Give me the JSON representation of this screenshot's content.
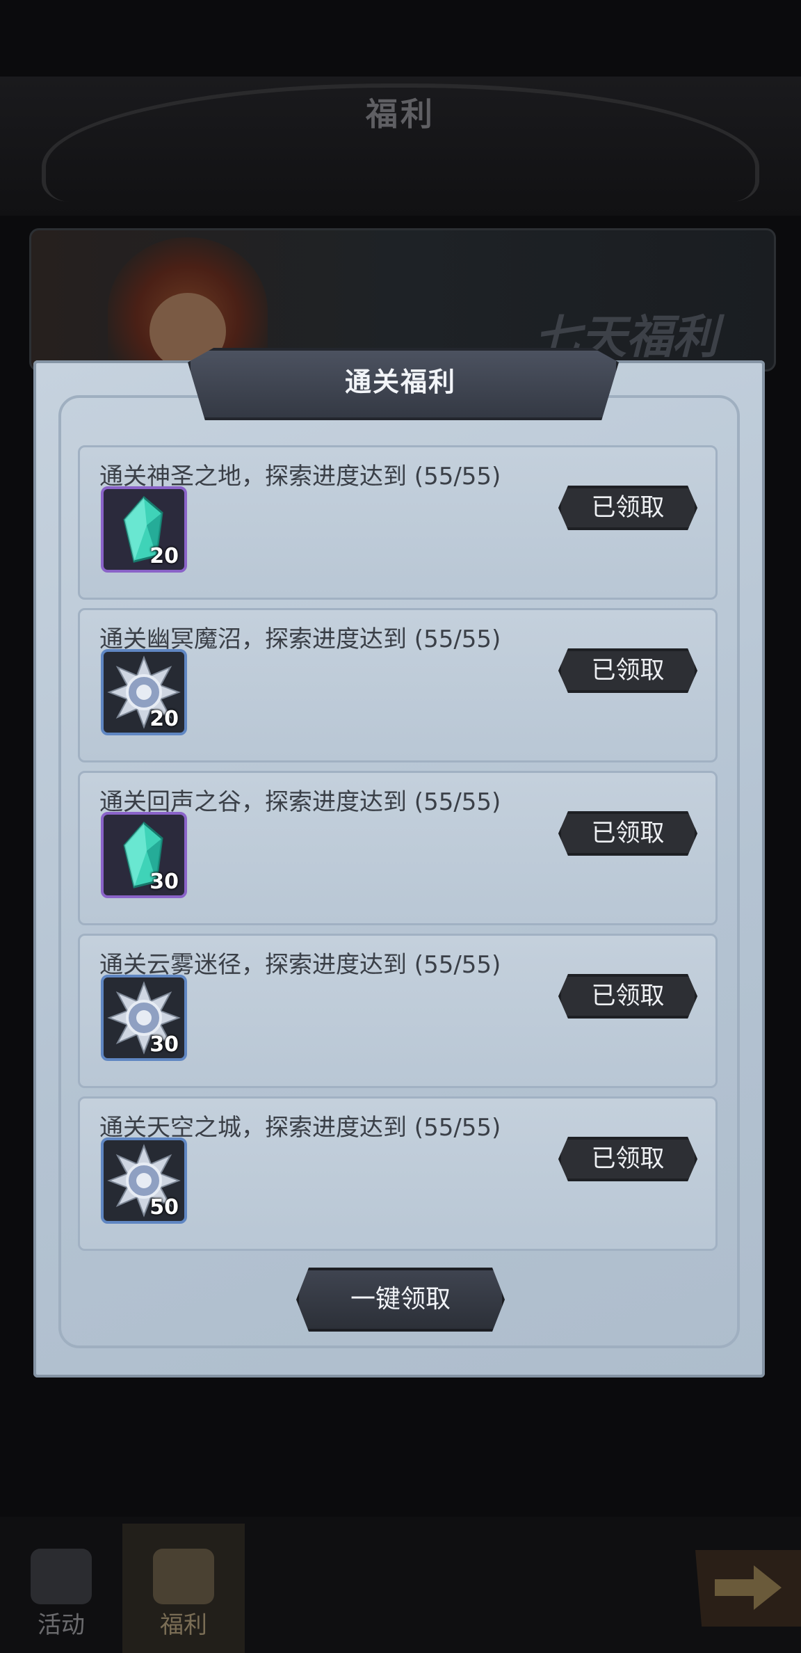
{
  "header": {
    "title": "福利"
  },
  "banner": {
    "title": "七天福利"
  },
  "panel": {
    "title": "通关福利"
  },
  "rows": [
    {
      "text": "通关神圣之地，探索进度达到 (55/55)",
      "item_icon": "crystal-icon",
      "item_frame": "purple",
      "count": "20",
      "button": "已领取"
    },
    {
      "text": "通关幽冥魔沼，探索进度达到 (55/55)",
      "item_icon": "silver-medal-icon",
      "item_frame": "blue",
      "count": "20",
      "button": "已领取"
    },
    {
      "text": "通关回声之谷，探索进度达到 (55/55)",
      "item_icon": "crystal-icon",
      "item_frame": "purple",
      "count": "30",
      "button": "已领取"
    },
    {
      "text": "通关云雾迷径，探索进度达到 (55/55)",
      "item_icon": "silver-medal-icon",
      "item_frame": "blue",
      "count": "30",
      "button": "已领取"
    },
    {
      "text": "通关天空之城，探索进度达到 (55/55)",
      "item_icon": "silver-medal-icon",
      "item_frame": "blue",
      "count": "50",
      "button": "已领取"
    }
  ],
  "one_key_button": "一键领取",
  "tabs": [
    {
      "label": "活动",
      "icon": "activity-icon"
    },
    {
      "label": "福利",
      "icon": "gift-icon"
    }
  ],
  "colors": {
    "panel_bg": "#b9c7d5",
    "button_dark": "#2d2f34",
    "purple_frame": "#8a63c8",
    "blue_frame": "#5f86c2",
    "crystal": "#3fd3b8"
  }
}
